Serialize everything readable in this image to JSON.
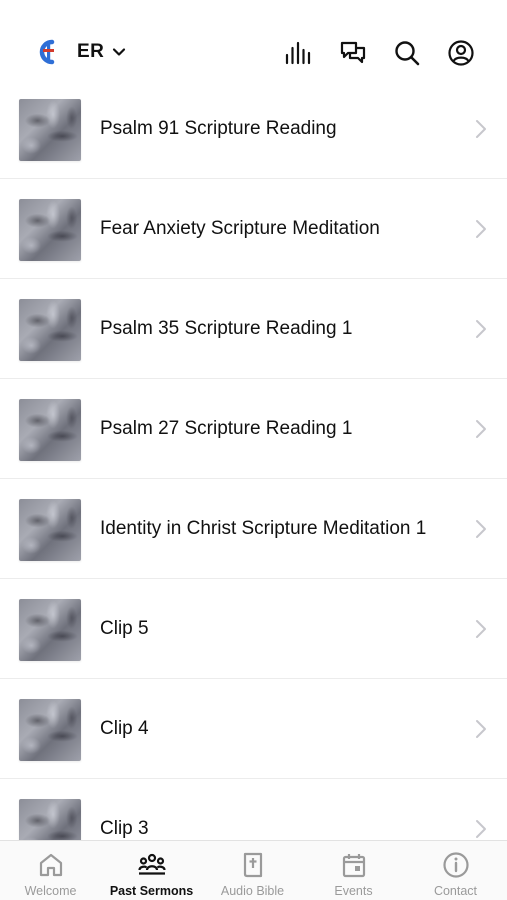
{
  "header": {
    "logo_icon": "church-logo-icon",
    "account_label": "ER",
    "account_chevron_icon": "chevron-down-icon",
    "actions": [
      {
        "name": "audio-levels-icon"
      },
      {
        "name": "chat-icon"
      },
      {
        "name": "search-icon"
      },
      {
        "name": "profile-icon"
      }
    ]
  },
  "sermons": [
    {
      "title": "Psalm 91 Scripture Reading"
    },
    {
      "title": "Fear Anxiety Scripture Meditation"
    },
    {
      "title": "Psalm 35 Scripture Reading 1"
    },
    {
      "title": "Psalm 27 Scripture Reading 1"
    },
    {
      "title": "Identity in Christ Scripture Meditation 1"
    },
    {
      "title": "Clip 5"
    },
    {
      "title": "Clip 4"
    },
    {
      "title": "Clip 3"
    }
  ],
  "tabbar": {
    "tabs": [
      {
        "label": "Welcome",
        "icon": "home-icon",
        "active": false
      },
      {
        "label": "Past Sermons",
        "icon": "people-icon",
        "active": true
      },
      {
        "label": "Audio Bible",
        "icon": "bible-icon",
        "active": false
      },
      {
        "label": "Events",
        "icon": "calendar-icon",
        "active": false
      },
      {
        "label": "Contact",
        "icon": "info-icon",
        "active": false
      }
    ]
  },
  "colors": {
    "accent_blue": "#2f6fd6",
    "accent_red": "#d33b2c",
    "text": "#111111",
    "inactive": "#9a9a9a"
  }
}
